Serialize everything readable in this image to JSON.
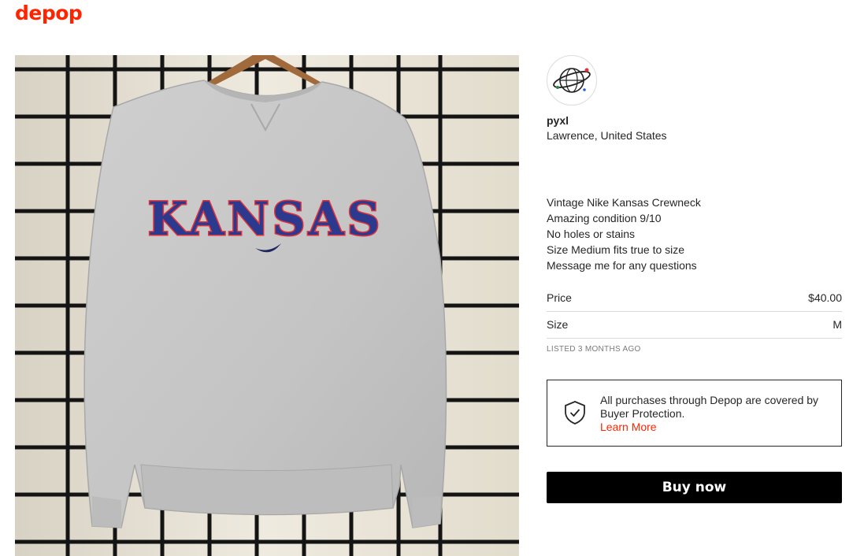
{
  "brand": {
    "logo_text": "depop",
    "color": "#ff2300"
  },
  "product": {
    "image_alt": "Grey crewneck sweatshirt on a hanger against a wire grid wall",
    "print_text": "KANSAS",
    "sweatshirt_color": "#c9c9c9",
    "lettering_color": "#2b3a8f",
    "outline_color": "#e0323a"
  },
  "seller": {
    "avatar_icon": "globe-logo-icon",
    "username": "pyxl",
    "location": "Lawrence, United States"
  },
  "description": [
    "Vintage Nike Kansas Crewneck",
    "Amazing condition 9/10",
    "No holes or stains",
    "Size Medium fits true to size",
    "Message me for any questions"
  ],
  "attributes": {
    "price_label": "Price",
    "price_value": "$40.00",
    "size_label": "Size",
    "size_value": "M"
  },
  "listed": "LISTED 3 MONTHS AGO",
  "protection": {
    "icon": "shield-check-icon",
    "text": "All purchases through Depop are covered by Buyer Protection.",
    "link": "Learn More"
  },
  "cta": {
    "label": "Buy now",
    "bg": "#000000",
    "fg": "#ffffff"
  }
}
